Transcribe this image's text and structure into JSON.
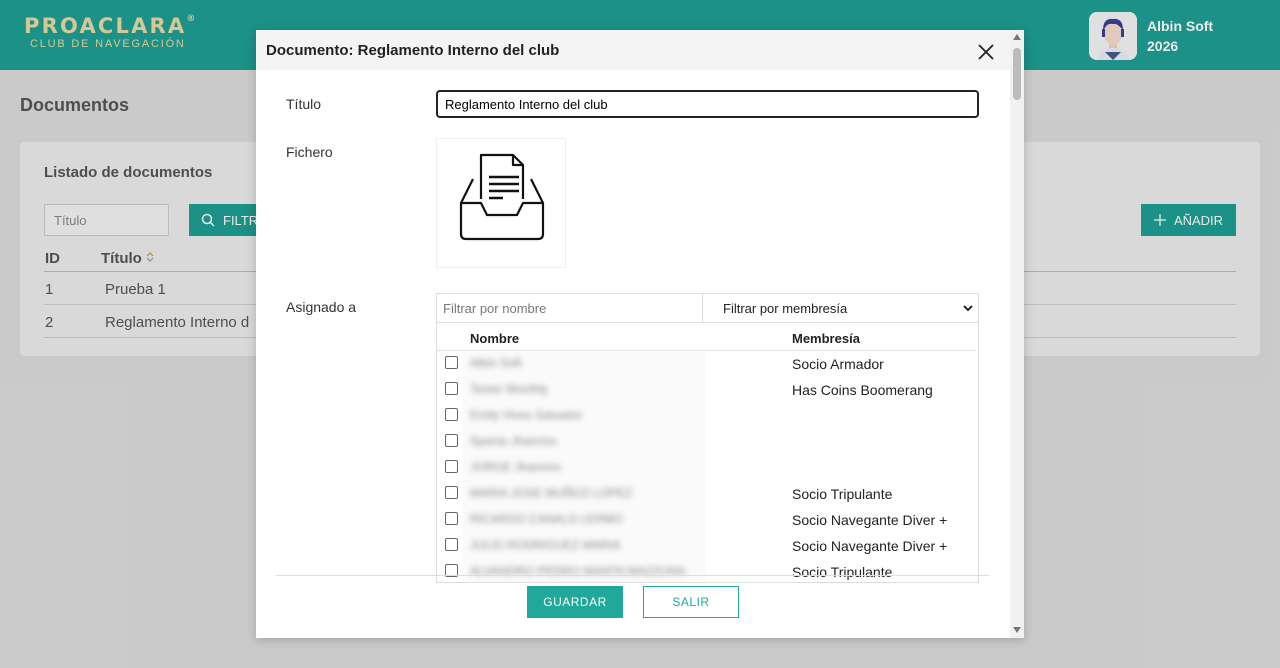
{
  "header": {
    "logo_main": "PROACLARA",
    "logo_reg": "®",
    "logo_sub": "CLUB DE NAVEGACIÓN",
    "user_name": "Albin Soft",
    "user_year": "2026",
    "color": "#1f9e93"
  },
  "page": {
    "title": "Documentos",
    "card_title": "Listado de documentos",
    "search_placeholder": "Título",
    "filter_label": "FILTR",
    "add_label": "AÑADIR",
    "columns": [
      "ID",
      "Título"
    ],
    "sort_icon": "sort-icon",
    "rows": [
      {
        "id": "1",
        "title": "Prueba 1"
      },
      {
        "id": "2",
        "title": "Reglamento Interno d"
      }
    ]
  },
  "modal": {
    "title": "Documento: Reglamento Interno del club",
    "labels": {
      "titulo": "Título",
      "fichero": "Fichero",
      "asignado": "Asignado a"
    },
    "title_value": "Reglamento Interno del club",
    "file_icon": "document-inbox-icon",
    "filter_name_placeholder": "Filtrar por nombre",
    "filter_membership": "Filtrar por membresía",
    "list_headers": {
      "name": "Nombre",
      "membership": "Membresía"
    },
    "members": [
      {
        "name": "Albin Soft",
        "membership": "Socio Armador"
      },
      {
        "name": "Tester Monthly",
        "membership": "Has Coins Boomerang"
      },
      {
        "name": "Emily Vives Salvador",
        "membership": ""
      },
      {
        "name": "Spania Jhanrino",
        "membership": ""
      },
      {
        "name": "JORGE Jhanrino",
        "membership": ""
      },
      {
        "name": "MARIA JOSE MUÑOZ LOPEZ",
        "membership": "Socio Tripulante"
      },
      {
        "name": "RICARDO CANALS LERMO",
        "membership": "Socio Navegante Diver +"
      },
      {
        "name": "JULIO RODRIGUEZ MARIA",
        "membership": "Socio Navegante Diver +"
      },
      {
        "name": "ALVANDRO PEDRO MANTA MAZZUNA",
        "membership": "Socio Tripulante"
      }
    ],
    "save_label": "GUARDAR",
    "exit_label": "SALIR",
    "accent": "#20a99b"
  }
}
